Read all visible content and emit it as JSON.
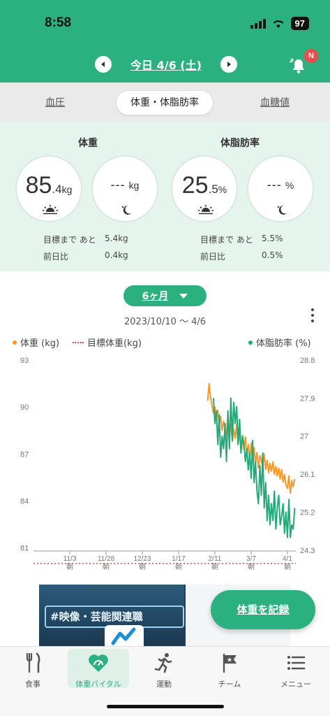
{
  "status": {
    "time": "8:58",
    "battery": "97"
  },
  "header": {
    "date": "今日 4/6 (土)",
    "notification_badge": "N"
  },
  "tabs": [
    "血圧",
    "体重・体脂肪率",
    "血糖値"
  ],
  "summary": {
    "weight": {
      "title": "体重",
      "morning": {
        "int": "85",
        "dec": ".4",
        "unit": "kg"
      },
      "night": {
        "value": "---",
        "unit": "kg"
      },
      "goal_label": "目標まで あと",
      "goal_value": "5.4kg",
      "diff_label": "前日比",
      "diff_value": "0.4kg"
    },
    "body_fat": {
      "title": "体脂肪率",
      "morning": {
        "int": "25",
        "dec": ".5",
        "unit": "%"
      },
      "night": {
        "value": "---",
        "unit": "%"
      },
      "goal_label": "目標まで あと",
      "goal_value": "5.5%",
      "diff_label": "前日比",
      "diff_value": "0.5%"
    }
  },
  "chart_controls": {
    "period": "6ヶ月",
    "range": "2023/10/10 〜 4/6"
  },
  "legend": {
    "weight": "体重 (kg)",
    "target": "目標体重(kg)",
    "body_fat": "体脂肪率 (%)"
  },
  "colors": {
    "brand": "#2bb07f",
    "weight_line": "#f39a2b",
    "fat_line": "#25a97b",
    "target_line": "#e34a4a"
  },
  "chart_data": {
    "type": "line",
    "x_ticks": [
      "11/3",
      "11/28",
      "12/23",
      "1/17",
      "2/11",
      "3/7",
      "4/1"
    ],
    "x_tick_sublabel": "朝",
    "y_left_ticks": [
      "93",
      "90",
      "87",
      "84",
      "81"
    ],
    "y_right_ticks": [
      "28.8",
      "27.9",
      "27",
      "26.1",
      "25.2",
      "24.3"
    ],
    "y_left_range": [
      80.8,
      93
    ],
    "y_right_range": [
      24.28,
      28.8
    ],
    "target_weight": 80,
    "series": [
      {
        "name": "体重 (kg)",
        "axis": "left",
        "x": [
          "2024-02-06",
          "2024-02-07",
          "2024-02-08",
          "2024-02-09",
          "2024-02-10",
          "2024-02-11",
          "2024-02-12",
          "2024-02-13",
          "2024-02-14",
          "2024-02-15",
          "2024-02-16",
          "2024-02-17",
          "2024-02-18",
          "2024-02-19",
          "2024-02-20",
          "2024-02-21",
          "2024-02-22",
          "2024-02-23",
          "2024-02-24",
          "2024-02-25",
          "2024-02-26",
          "2024-02-27",
          "2024-02-28",
          "2024-02-29",
          "2024-03-01",
          "2024-03-02",
          "2024-03-03",
          "2024-03-04",
          "2024-03-05",
          "2024-03-06",
          "2024-03-07",
          "2024-03-08",
          "2024-03-09",
          "2024-03-10",
          "2024-03-11",
          "2024-03-12",
          "2024-03-13",
          "2024-03-14",
          "2024-03-15",
          "2024-03-16",
          "2024-03-17",
          "2024-03-18",
          "2024-03-19",
          "2024-03-20",
          "2024-03-21",
          "2024-03-22",
          "2024-03-23",
          "2024-03-24",
          "2024-03-25",
          "2024-03-26",
          "2024-03-27",
          "2024-03-28",
          "2024-03-29",
          "2024-03-30",
          "2024-03-31",
          "2024-04-01",
          "2024-04-02",
          "2024-04-03",
          "2024-04-04",
          "2024-04-05",
          "2024-04-06"
        ],
        "values": [
          90.4,
          91.5,
          90.6,
          90.1,
          89.6,
          90.0,
          89.2,
          89.8,
          88.9,
          89.4,
          88.5,
          89.1,
          88.6,
          88.2,
          89.5,
          88.3,
          88.9,
          87.8,
          88.6,
          88.0,
          88.9,
          87.6,
          88.4,
          87.2,
          88.2,
          87.3,
          88.1,
          86.9,
          87.6,
          86.7,
          87.7,
          86.5,
          87.4,
          86.4,
          87.1,
          86.1,
          86.9,
          86.6,
          86.2,
          87.0,
          86.0,
          86.6,
          85.8,
          86.4,
          85.9,
          86.5,
          85.7,
          86.2,
          85.6,
          86.1,
          85.4,
          86.0,
          85.2,
          85.7,
          85.0,
          84.8,
          85.6,
          84.5,
          85.3,
          84.9,
          85.4
        ]
      },
      {
        "name": "体脂肪率 (%)",
        "axis": "right",
        "x": [
          "2024-02-10",
          "2024-02-11",
          "2024-02-12",
          "2024-02-13",
          "2024-02-14",
          "2024-02-15",
          "2024-02-16",
          "2024-02-17",
          "2024-02-18",
          "2024-02-19",
          "2024-02-20",
          "2024-02-21",
          "2024-02-22",
          "2024-02-23",
          "2024-02-24",
          "2024-02-25",
          "2024-02-26",
          "2024-02-27",
          "2024-02-28",
          "2024-02-29",
          "2024-03-01",
          "2024-03-02",
          "2024-03-03",
          "2024-03-04",
          "2024-03-05",
          "2024-03-06",
          "2024-03-07",
          "2024-03-08",
          "2024-03-09",
          "2024-03-10",
          "2024-03-11",
          "2024-03-12",
          "2024-03-13",
          "2024-03-14",
          "2024-03-15",
          "2024-03-16",
          "2024-03-17",
          "2024-03-18",
          "2024-03-19",
          "2024-03-20",
          "2024-03-21",
          "2024-03-22",
          "2024-03-23",
          "2024-03-24",
          "2024-03-25",
          "2024-03-26",
          "2024-03-27",
          "2024-03-28",
          "2024-03-29",
          "2024-03-30",
          "2024-03-31",
          "2024-04-01",
          "2024-04-02",
          "2024-04-03",
          "2024-04-04",
          "2024-04-05",
          "2024-04-06"
        ],
        "values": [
          27.9,
          27.3,
          27.6,
          26.8,
          27.5,
          26.5,
          27.0,
          26.7,
          27.3,
          26.4,
          27.6,
          26.7,
          27.9,
          26.9,
          27.8,
          27.3,
          27.7,
          26.8,
          27.4,
          26.6,
          27.0,
          26.8,
          26.4,
          26.7,
          26.2,
          26.6,
          26.0,
          26.9,
          25.9,
          26.4,
          25.7,
          25.4,
          26.3,
          25.6,
          26.6,
          25.3,
          25.9,
          25.0,
          25.6,
          24.9,
          25.4,
          25.0,
          25.7,
          24.8,
          25.3,
          25.6,
          24.9,
          25.1,
          25.4,
          24.7,
          25.2,
          24.6,
          25.5,
          24.6,
          24.9,
          24.8,
          25.3
        ]
      }
    ]
  },
  "ad": {
    "headline": "#映像・芸能関連職"
  },
  "fab": {
    "label": "体重を記録"
  },
  "bottom_nav": [
    "食事",
    "体重バイタル",
    "運動",
    "チーム",
    "メニュー"
  ]
}
